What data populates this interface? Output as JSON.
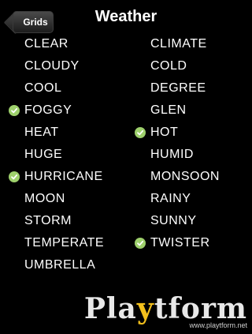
{
  "navbar": {
    "back_label": "Grids",
    "title": "Weather"
  },
  "words": [
    {
      "text": "CLEAR",
      "checked": false
    },
    {
      "text": "CLIMATE",
      "checked": false
    },
    {
      "text": "CLOUDY",
      "checked": false
    },
    {
      "text": "COLD",
      "checked": false
    },
    {
      "text": "COOL",
      "checked": false
    },
    {
      "text": "DEGREE",
      "checked": false
    },
    {
      "text": "FOGGY",
      "checked": true
    },
    {
      "text": "GLEN",
      "checked": false
    },
    {
      "text": "HEAT",
      "checked": false
    },
    {
      "text": "HOT",
      "checked": true
    },
    {
      "text": "HUGE",
      "checked": false
    },
    {
      "text": "HUMID",
      "checked": false
    },
    {
      "text": "HURRICANE",
      "checked": true
    },
    {
      "text": "MONSOON",
      "checked": false
    },
    {
      "text": "MOON",
      "checked": false
    },
    {
      "text": "RAINY",
      "checked": false
    },
    {
      "text": "STORM",
      "checked": false
    },
    {
      "text": "SUNNY",
      "checked": false
    },
    {
      "text": "TEMPERATE",
      "checked": false
    },
    {
      "text": "TWISTER",
      "checked": true
    },
    {
      "text": "UMBRELLA",
      "checked": false
    }
  ],
  "watermark": {
    "logo_pre": "Pla",
    "logo_y": "y",
    "logo_post": "tform",
    "url": "www.playtform.net"
  },
  "colors": {
    "check": "#9ed06c",
    "background": "#000000",
    "text": "#ffffff",
    "logo_accent": "#f3c01c"
  }
}
